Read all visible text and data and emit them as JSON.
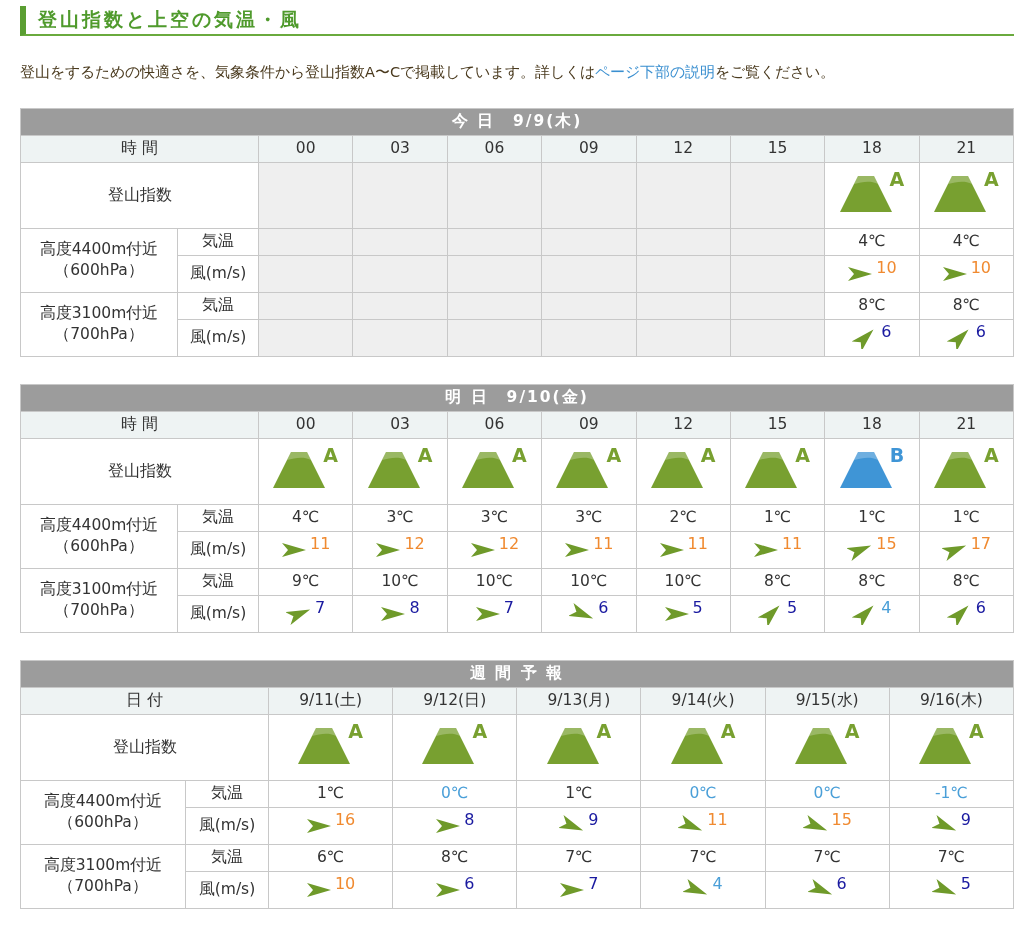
{
  "heading": "登山指数と上空の気温・風",
  "intro": {
    "before": "登山をするための快適さを、気象条件から登山指数A〜Cで掲載しています。詳しくは",
    "link": "ページ下部の説明",
    "after": "をご覧ください。"
  },
  "tables": [
    {
      "title": "今 日　9/9(木)",
      "header_label": "時 間",
      "index_label": "登山指数",
      "levels": [
        {
          "altitude": "高度4400m付近",
          "pressure": "（600hPa）",
          "temp_label": "気温",
          "wind_label": "風(m/s)"
        },
        {
          "altitude": "高度3100m付近",
          "pressure": "（700hPa）",
          "temp_label": "気温",
          "wind_label": "風(m/s)"
        }
      ],
      "columns": [
        {
          "label": "00",
          "available": false
        },
        {
          "label": "03",
          "available": false
        },
        {
          "label": "06",
          "available": false
        },
        {
          "label": "09",
          "available": false
        },
        {
          "label": "12",
          "available": false
        },
        {
          "label": "15",
          "available": false
        },
        {
          "label": "18",
          "available": true,
          "grade": "A",
          "color": "#78a030",
          "levels": [
            {
              "temp": {
                "text": "4℃",
                "color": "#333333"
              },
              "wind": {
                "kind": "east",
                "speed": "10",
                "color": "#f08a30"
              }
            },
            {
              "temp": {
                "text": "8℃",
                "color": "#333333"
              },
              "wind": {
                "kind": "northeast",
                "speed": "6",
                "color": "#1a1aa0"
              }
            }
          ]
        },
        {
          "label": "21",
          "available": true,
          "grade": "A",
          "color": "#78a030",
          "levels": [
            {
              "temp": {
                "text": "4℃",
                "color": "#333333"
              },
              "wind": {
                "kind": "east",
                "speed": "10",
                "color": "#f08a30"
              }
            },
            {
              "temp": {
                "text": "8℃",
                "color": "#333333"
              },
              "wind": {
                "kind": "northeast",
                "speed": "6",
                "color": "#1a1aa0"
              }
            }
          ]
        }
      ]
    },
    {
      "title": "明 日　9/10(金)",
      "header_label": "時 間",
      "index_label": "登山指数",
      "levels": [
        {
          "altitude": "高度4400m付近",
          "pressure": "（600hPa）",
          "temp_label": "気温",
          "wind_label": "風(m/s)"
        },
        {
          "altitude": "高度3100m付近",
          "pressure": "（700hPa）",
          "temp_label": "気温",
          "wind_label": "風(m/s)"
        }
      ],
      "columns": [
        {
          "label": "00",
          "available": true,
          "grade": "A",
          "color": "#78a030",
          "levels": [
            {
              "temp": {
                "text": "4℃",
                "color": "#333333"
              },
              "wind": {
                "kind": "east",
                "speed": "11",
                "color": "#f08a30"
              }
            },
            {
              "temp": {
                "text": "9℃",
                "color": "#333333"
              },
              "wind": {
                "kind": "eastnortheast",
                "speed": "7",
                "color": "#1a1aa0"
              }
            }
          ]
        },
        {
          "label": "03",
          "available": true,
          "grade": "A",
          "color": "#78a030",
          "levels": [
            {
              "temp": {
                "text": "3℃",
                "color": "#333333"
              },
              "wind": {
                "kind": "east",
                "speed": "12",
                "color": "#f08a30"
              }
            },
            {
              "temp": {
                "text": "10℃",
                "color": "#333333"
              },
              "wind": {
                "kind": "east",
                "speed": "8",
                "color": "#1a1aa0"
              }
            }
          ]
        },
        {
          "label": "06",
          "available": true,
          "grade": "A",
          "color": "#78a030",
          "levels": [
            {
              "temp": {
                "text": "3℃",
                "color": "#333333"
              },
              "wind": {
                "kind": "east",
                "speed": "12",
                "color": "#f08a30"
              }
            },
            {
              "temp": {
                "text": "10℃",
                "color": "#333333"
              },
              "wind": {
                "kind": "east",
                "speed": "7",
                "color": "#1a1aa0"
              }
            }
          ]
        },
        {
          "label": "09",
          "available": true,
          "grade": "A",
          "color": "#78a030",
          "levels": [
            {
              "temp": {
                "text": "3℃",
                "color": "#333333"
              },
              "wind": {
                "kind": "east",
                "speed": "11",
                "color": "#f08a30"
              }
            },
            {
              "temp": {
                "text": "10℃",
                "color": "#333333"
              },
              "wind": {
                "kind": "eastsoutheast",
                "speed": "6",
                "color": "#1a1aa0"
              }
            }
          ]
        },
        {
          "label": "12",
          "available": true,
          "grade": "A",
          "color": "#78a030",
          "levels": [
            {
              "temp": {
                "text": "2℃",
                "color": "#333333"
              },
              "wind": {
                "kind": "east",
                "speed": "11",
                "color": "#f08a30"
              }
            },
            {
              "temp": {
                "text": "10℃",
                "color": "#333333"
              },
              "wind": {
                "kind": "east",
                "speed": "5",
                "color": "#1a1aa0"
              }
            }
          ]
        },
        {
          "label": "15",
          "available": true,
          "grade": "A",
          "color": "#78a030",
          "levels": [
            {
              "temp": {
                "text": "1℃",
                "color": "#333333"
              },
              "wind": {
                "kind": "east",
                "speed": "11",
                "color": "#f08a30"
              }
            },
            {
              "temp": {
                "text": "8℃",
                "color": "#333333"
              },
              "wind": {
                "kind": "northeast",
                "speed": "5",
                "color": "#1a1aa0"
              }
            }
          ]
        },
        {
          "label": "18",
          "available": true,
          "grade": "B",
          "color": "#3f95d6",
          "levels": [
            {
              "temp": {
                "text": "1℃",
                "color": "#333333"
              },
              "wind": {
                "kind": "eastnortheast",
                "speed": "15",
                "color": "#f08a30"
              }
            },
            {
              "temp": {
                "text": "8℃",
                "color": "#333333"
              },
              "wind": {
                "kind": "northeast",
                "speed": "4",
                "color": "#4a9fd8"
              }
            }
          ]
        },
        {
          "label": "21",
          "available": true,
          "grade": "A",
          "color": "#78a030",
          "levels": [
            {
              "temp": {
                "text": "1℃",
                "color": "#333333"
              },
              "wind": {
                "kind": "eastnortheast",
                "speed": "17",
                "color": "#f08a30"
              }
            },
            {
              "temp": {
                "text": "8℃",
                "color": "#333333"
              },
              "wind": {
                "kind": "northeast",
                "speed": "6",
                "color": "#1a1aa0"
              }
            }
          ]
        }
      ]
    },
    {
      "title": "週 間 予 報",
      "header_label": "日 付",
      "index_label": "登山指数",
      "levels": [
        {
          "altitude": "高度4400m付近",
          "pressure": "（600hPa）",
          "temp_label": "気温",
          "wind_label": "風(m/s)"
        },
        {
          "altitude": "高度3100m付近",
          "pressure": "（700hPa）",
          "temp_label": "気温",
          "wind_label": "風(m/s)"
        }
      ],
      "columns": [
        {
          "label": "9/11(土)",
          "available": true,
          "grade": "A",
          "color": "#78a030",
          "levels": [
            {
              "temp": {
                "text": "1℃",
                "color": "#333333"
              },
              "wind": {
                "kind": "east",
                "speed": "16",
                "color": "#f08a30"
              }
            },
            {
              "temp": {
                "text": "6℃",
                "color": "#333333"
              },
              "wind": {
                "kind": "east",
                "speed": "10",
                "color": "#f08a30"
              }
            }
          ]
        },
        {
          "label": "9/12(日)",
          "available": true,
          "grade": "A",
          "color": "#78a030",
          "levels": [
            {
              "temp": {
                "text": "0℃",
                "color": "#4a9fd8"
              },
              "wind": {
                "kind": "east",
                "speed": "8",
                "color": "#1a1aa0"
              }
            },
            {
              "temp": {
                "text": "8℃",
                "color": "#333333"
              },
              "wind": {
                "kind": "east",
                "speed": "6",
                "color": "#1a1aa0"
              }
            }
          ]
        },
        {
          "label": "9/13(月)",
          "available": true,
          "grade": "A",
          "color": "#78a030",
          "levels": [
            {
              "temp": {
                "text": "1℃",
                "color": "#333333"
              },
              "wind": {
                "kind": "eastsoutheast",
                "speed": "9",
                "color": "#1a1aa0"
              }
            },
            {
              "temp": {
                "text": "7℃",
                "color": "#333333"
              },
              "wind": {
                "kind": "east",
                "speed": "7",
                "color": "#1a1aa0"
              }
            }
          ]
        },
        {
          "label": "9/14(火)",
          "available": true,
          "grade": "A",
          "color": "#78a030",
          "levels": [
            {
              "temp": {
                "text": "0℃",
                "color": "#4a9fd8"
              },
              "wind": {
                "kind": "eastsoutheast",
                "speed": "11",
                "color": "#f08a30"
              }
            },
            {
              "temp": {
                "text": "7℃",
                "color": "#333333"
              },
              "wind": {
                "kind": "eastsoutheast",
                "speed": "4",
                "color": "#4a9fd8"
              }
            }
          ]
        },
        {
          "label": "9/15(水)",
          "available": true,
          "grade": "A",
          "color": "#78a030",
          "levels": [
            {
              "temp": {
                "text": "0℃",
                "color": "#4a9fd8"
              },
              "wind": {
                "kind": "eastsoutheast",
                "speed": "15",
                "color": "#f08a30"
              }
            },
            {
              "temp": {
                "text": "7℃",
                "color": "#333333"
              },
              "wind": {
                "kind": "eastsoutheast",
                "speed": "6",
                "color": "#1a1aa0"
              }
            }
          ]
        },
        {
          "label": "9/16(木)",
          "available": true,
          "grade": "A",
          "color": "#78a030",
          "levels": [
            {
              "temp": {
                "text": "-1℃",
                "color": "#4a9fd8"
              },
              "wind": {
                "kind": "eastsoutheast",
                "speed": "9",
                "color": "#1a1aa0"
              }
            },
            {
              "temp": {
                "text": "7℃",
                "color": "#333333"
              },
              "wind": {
                "kind": "eastsoutheast",
                "speed": "5",
                "color": "#1a1aa0"
              }
            }
          ]
        }
      ]
    }
  ]
}
